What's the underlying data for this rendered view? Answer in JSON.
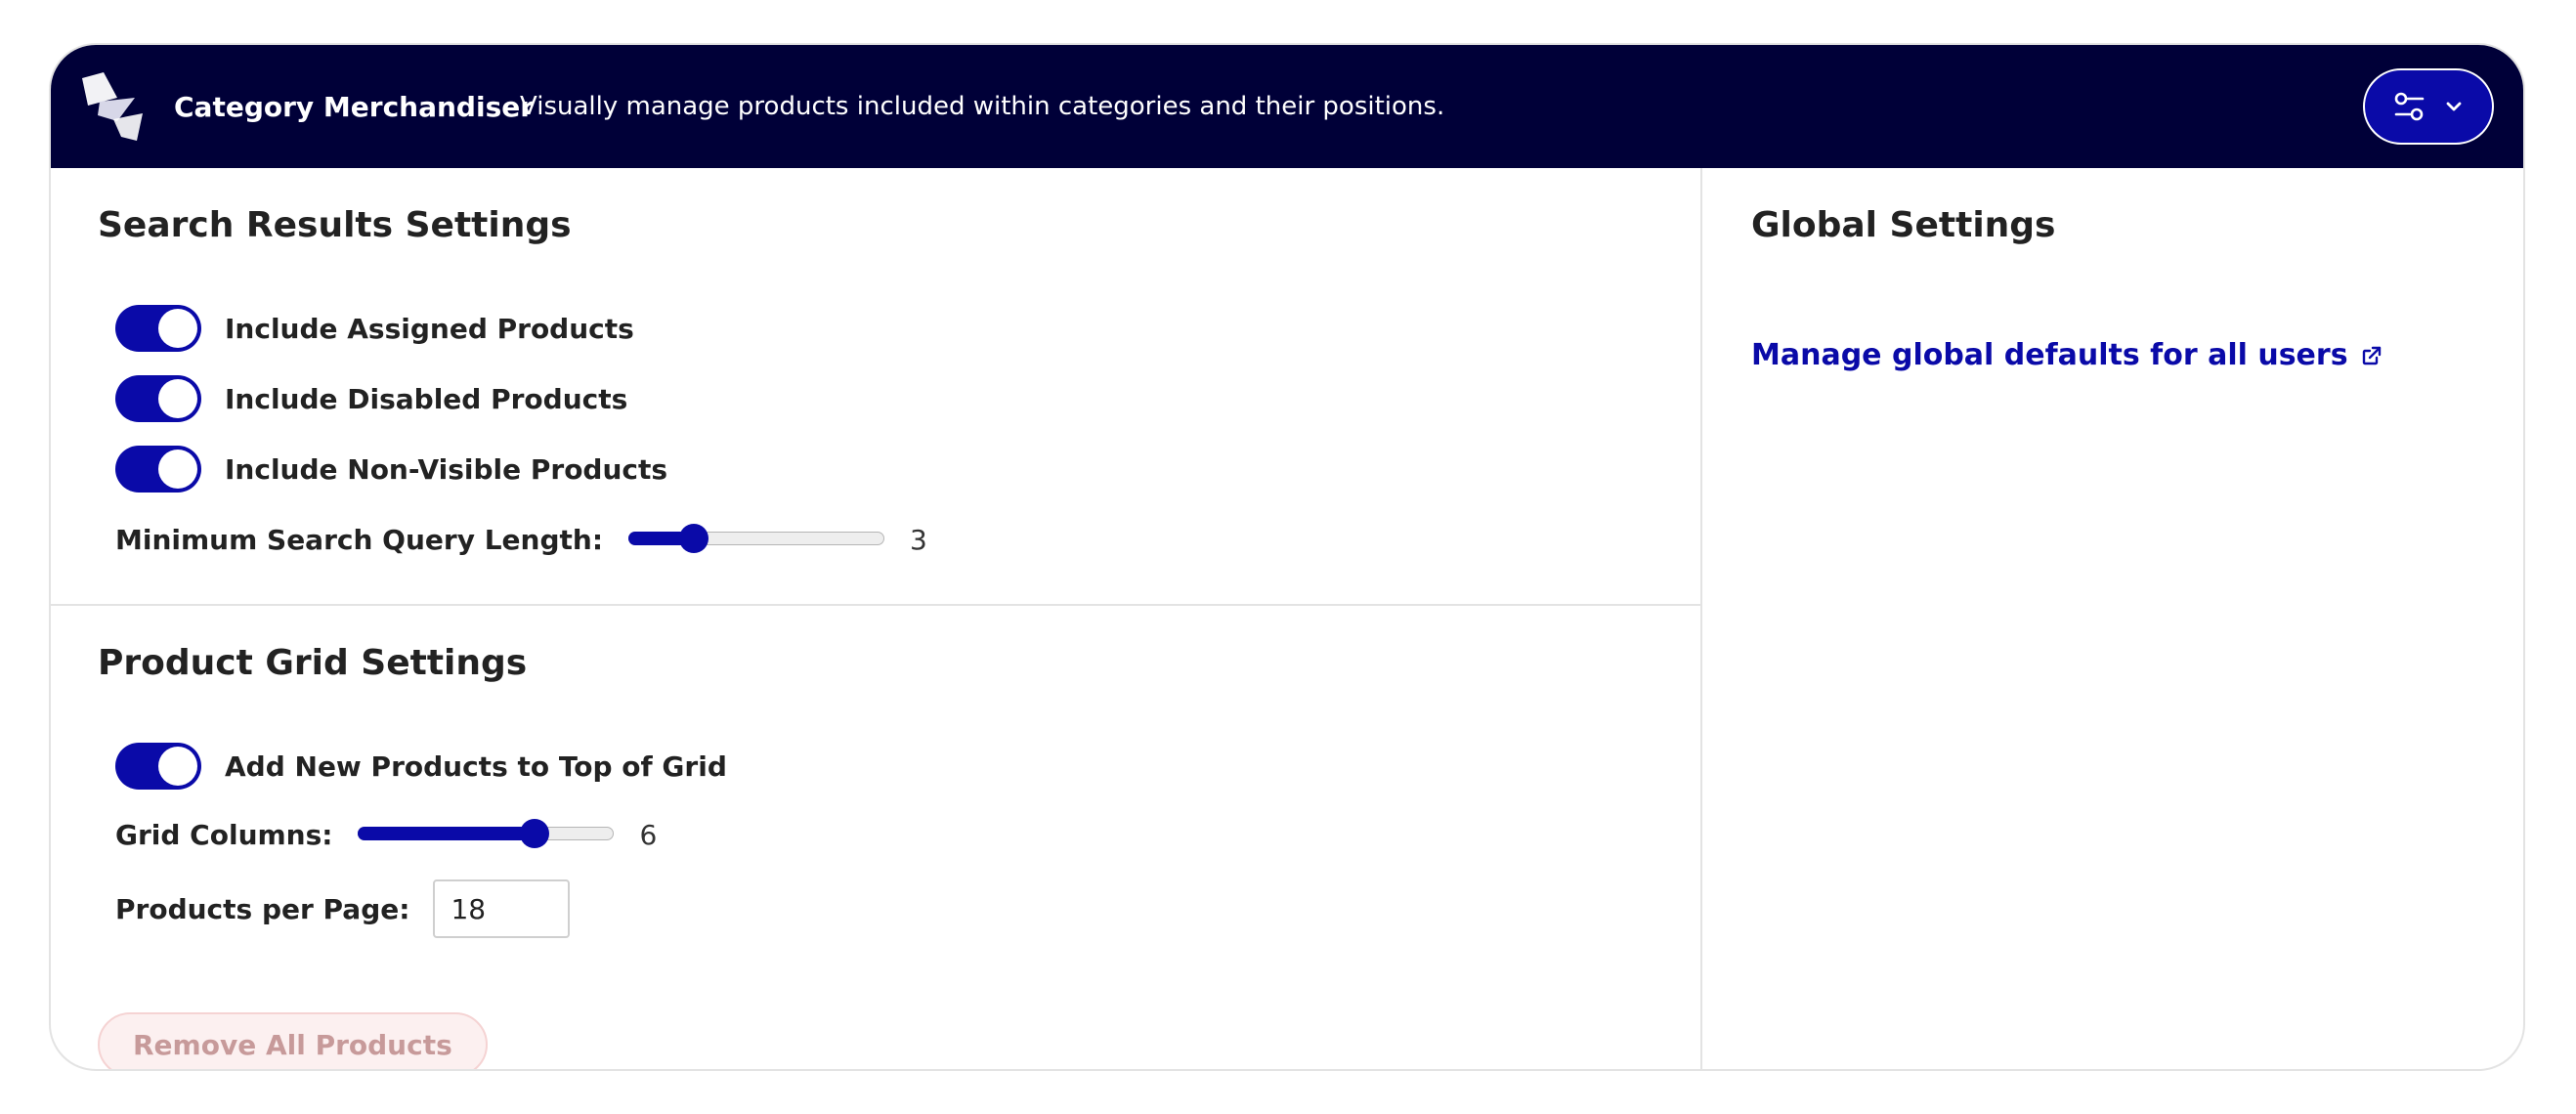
{
  "header": {
    "logo_icon": "category-merchandiser-logo",
    "title": "Category Merchandiser",
    "description": "Visually manage products included within categories and their positions.",
    "settings_icon": "sliders-icon",
    "dropdown_icon": "chevron-down-icon",
    "background_color": "#000038"
  },
  "search_settings": {
    "title": "Search Results Settings",
    "toggles": [
      {
        "label": "Include Assigned Products",
        "on": true
      },
      {
        "label": "Include Disabled Products",
        "on": true
      },
      {
        "label": "Include Non-Visible Products",
        "on": true
      }
    ],
    "min_query": {
      "label": "Minimum Search Query Length:",
      "value": "3",
      "min": 1,
      "max": 10
    }
  },
  "grid_settings": {
    "title": "Product Grid Settings",
    "toggle": {
      "label": "Add New Products to Top of Grid",
      "on": true
    },
    "columns": {
      "label": "Grid Columns:",
      "value": "6",
      "min": 1,
      "max": 8
    },
    "per_page": {
      "label": "Products per Page:",
      "value": "18"
    },
    "remove_button": "Remove All Products"
  },
  "global_settings": {
    "title": "Global Settings",
    "link_label": "Manage global defaults for all users",
    "link_icon": "external-link-icon"
  },
  "colors": {
    "accent": "#0a0aa8",
    "danger_text": "#c79a9a",
    "danger_bg": "#fcf0f0"
  }
}
